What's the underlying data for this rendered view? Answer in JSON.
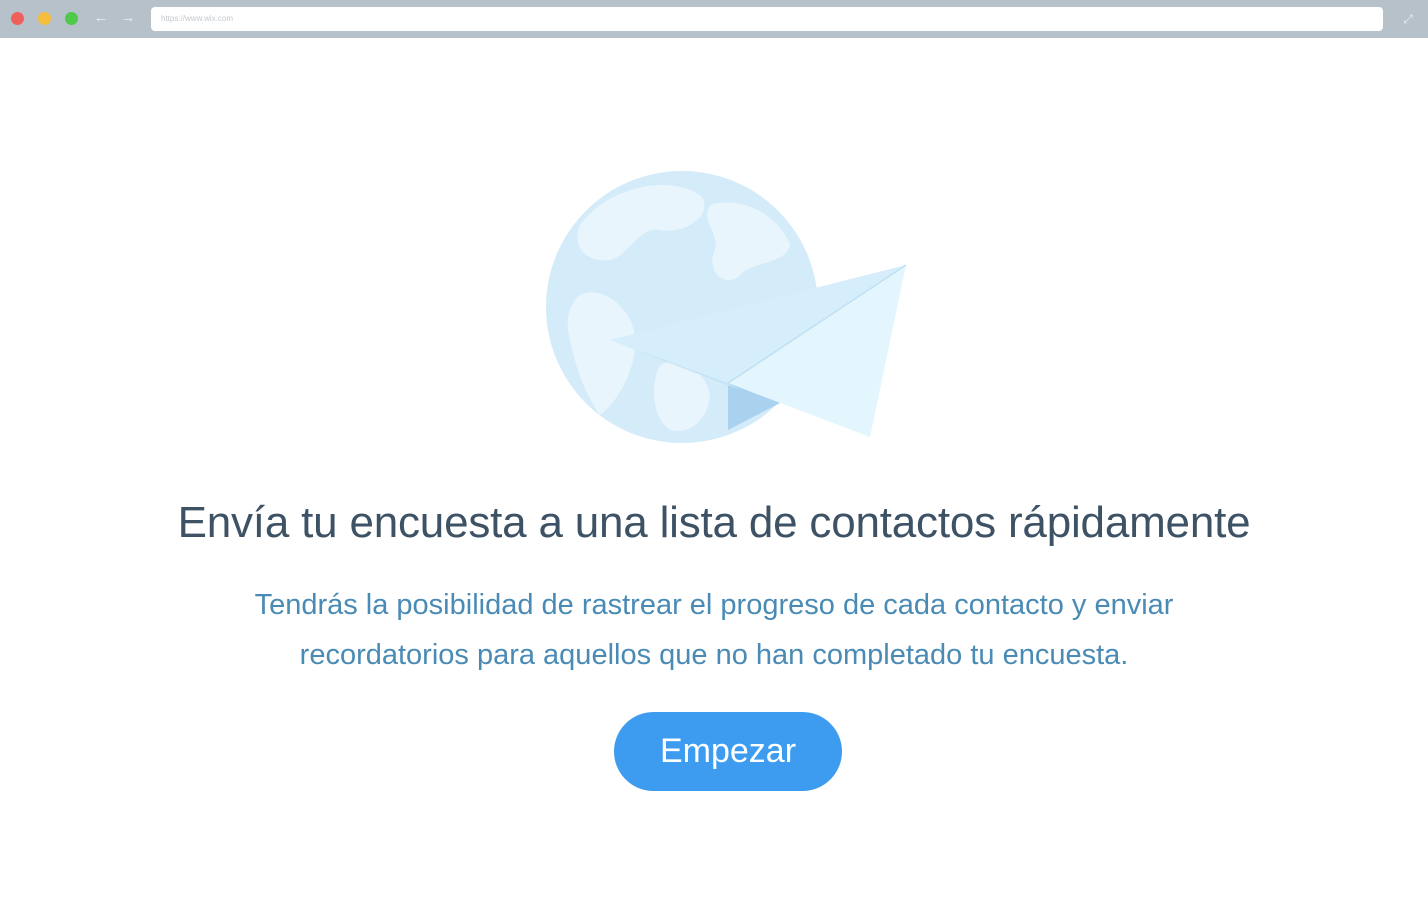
{
  "browser": {
    "url": "https://www.wix.com",
    "back_icon": "arrow-left-icon",
    "forward_icon": "arrow-right-icon",
    "expand_icon": "expand-icon",
    "back_glyph": "←",
    "forward_glyph": "→",
    "expand_glyph": "⤢"
  },
  "main": {
    "illustration": "globe-paper-plane-icon",
    "headline": "Envía tu encuesta a una lista de contactos rápidamente",
    "description_line1": "Tendrás la posibilidad de rastrear el progreso de cada contacto y enviar",
    "description_line2": "recordatorios para aquellos que no han completado tu encuesta.",
    "cta_label": "Empezar"
  },
  "colors": {
    "browser_bar": "#b7c1c9",
    "headline": "#3e5265",
    "description": "#4a8bb5",
    "button": "#3d9cef",
    "globe": "#d4ebf9",
    "plane": "#e1f4fd"
  }
}
